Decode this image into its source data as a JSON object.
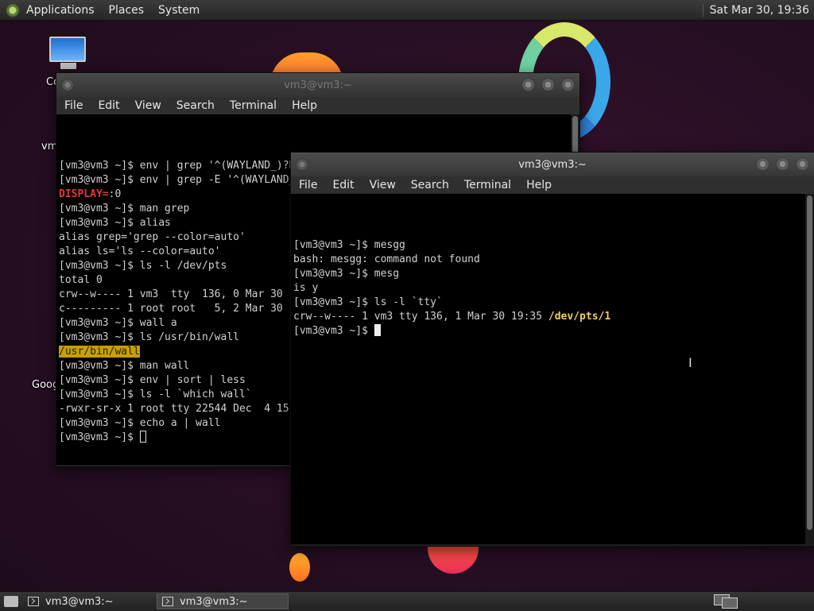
{
  "top_panel": {
    "menus": [
      "Applications",
      "Places",
      "System"
    ],
    "clock": "Sat Mar 30, 19:36"
  },
  "desktop": {
    "icon_labels": [
      "Co",
      "vm",
      "Goog"
    ]
  },
  "back_window": {
    "title": "vm3@vm3:~",
    "menu": [
      "File",
      "Edit",
      "View",
      "Search",
      "Terminal",
      "Help"
    ],
    "lines": [
      "[vm3@vm3 ~]$ env | grep '^(WAYLAND_)?DISPLAY='",
      "[vm3@vm3 ~]$ env | grep -E '^(WAYLAND_)?DISPLAY='",
      {
        "red": "DISPLAY=",
        "rest": ":0"
      },
      "[vm3@vm3 ~]$ man grep",
      "[vm3@vm3 ~]$ alias",
      "alias grep='grep --color=auto'",
      "alias ls='ls --color=auto'",
      "[vm3@vm3 ~]$ ls -l /dev/pts",
      "total 0",
      "crw--w---- 1 vm3  tty  136, 0 Mar 30",
      "c--------- 1 root root   5, 2 Mar 30",
      "[vm3@vm3 ~]$ wall a",
      "[vm3@vm3 ~]$ ls /usr/bin/wall",
      {
        "highlight": "/usr/bin/wall"
      },
      "[vm3@vm3 ~]$ man wall",
      "[vm3@vm3 ~]$ env | sort | less",
      "[vm3@vm3 ~]$ ls -l `which wall`",
      "-rwxr-sr-x 1 root tty 22544 Dec  4 15",
      "[vm3@vm3 ~]$ echo a | wall",
      {
        "prompt": "[vm3@vm3 ~]$ ",
        "cursor": "hollow"
      }
    ]
  },
  "front_window": {
    "title": "vm3@vm3:~",
    "menu": [
      "File",
      "Edit",
      "View",
      "Search",
      "Terminal",
      "Help"
    ],
    "lines": [
      "[vm3@vm3 ~]$ mesgg",
      "bash: mesgg: command not found",
      "[vm3@vm3 ~]$ mesg",
      "is y",
      "[vm3@vm3 ~]$ ls -l `tty`",
      {
        "text": "crw--w---- 1 vm3 tty 136, 1 Mar 30 19:35 ",
        "bold": "/dev/pts/1"
      },
      {
        "prompt": "[vm3@vm3 ~]$ ",
        "cursor": "solid"
      }
    ]
  },
  "taskbar": {
    "items": [
      {
        "label": "vm3@vm3:~",
        "active": false
      },
      {
        "label": "vm3@vm3:~",
        "active": true
      }
    ]
  },
  "colors": {
    "error_red": "#e03838",
    "highlight_bg": "#c8a000",
    "path_yellow": "#f0d060"
  }
}
